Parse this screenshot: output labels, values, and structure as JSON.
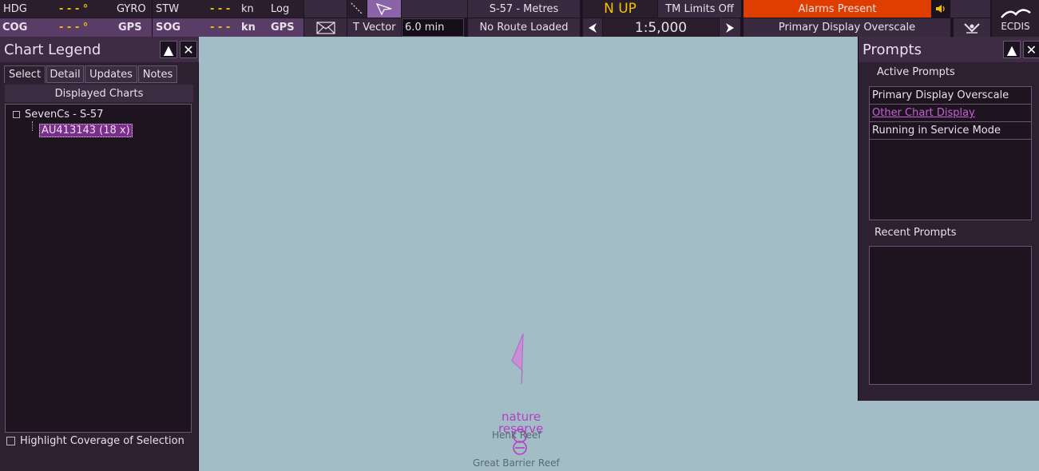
{
  "toolbar": {
    "row1": {
      "hdg_label": "HDG",
      "hdg_value": "- - - °",
      "hdg_source": "GYRO",
      "stw_label": "STW",
      "stw_value": "- - -",
      "stw_unit": "kn",
      "stw_source": "Log"
    },
    "row2": {
      "cog_label": "COG",
      "cog_value": "- - - °",
      "cog_source": "GPS",
      "sog_label": "SOG",
      "sog_value": "- - -",
      "sog_unit": "kn",
      "sog_source": "GPS"
    },
    "chart_standard": "S-57 - Metres",
    "route": "No Route Loaded",
    "vector_label": "T Vector",
    "vector_value": "6.0 min",
    "orientation": "N UP",
    "tm_limits": "TM Limits Off",
    "scale": "1:5,000",
    "alarms": "Alarms Present",
    "display_status": "Primary Display Overscale",
    "logo_text": "ECDIS"
  },
  "legend": {
    "title": "Chart Legend",
    "tabs": [
      "Select",
      "Detail",
      "Updates",
      "Notes"
    ],
    "subheader": "Displayed Charts",
    "tree_root": "SevenCs - S-57",
    "tree_child": "AU413143 (18 x)",
    "highlight_label": "Highlight Coverage of Selection"
  },
  "prompts": {
    "title": "Prompts",
    "active_header": "Active Prompts",
    "active": [
      "Primary Display Overscale",
      "Other Chart Display",
      "Running in Service Mode"
    ],
    "recent_header": "Recent Prompts"
  },
  "map": {
    "label_nature": "nature",
    "label_reserve": "reserve",
    "label_reef": "Henk Reef",
    "label_gbr": "Great Barrier Reef"
  },
  "colors": {
    "alarm_bg": "#e03d00",
    "accent_purple": "#c761d8",
    "sea": "#a2bdc6",
    "value_yellow": "#f2c200"
  }
}
